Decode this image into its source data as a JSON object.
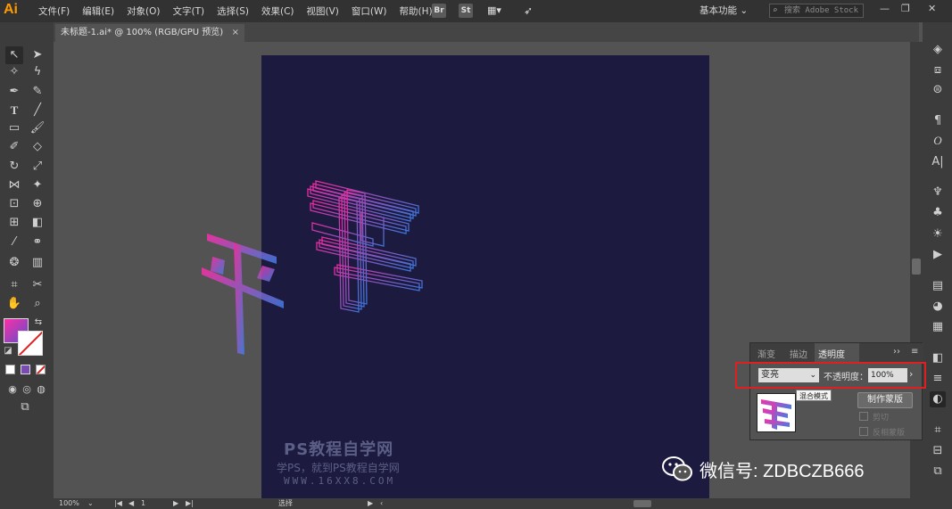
{
  "app": {
    "logo": "Ai"
  },
  "menu": [
    "文件(F)",
    "编辑(E)",
    "对象(O)",
    "文字(T)",
    "选择(S)",
    "效果(C)",
    "视图(V)",
    "窗口(W)",
    "帮助(H)"
  ],
  "menubar_icons": {
    "br": "Br",
    "st": "St"
  },
  "workspace": "基本功能",
  "stock_search": {
    "placeholder": "搜索 Adobe Stock"
  },
  "document_tab": {
    "title": "未标题-1.ai* @ 100% (RGB/GPU 预览)",
    "close": "×"
  },
  "transparency_panel": {
    "tabs": [
      "渐变",
      "描边",
      "透明度"
    ],
    "active_tab": "透明度",
    "blend_mode": "变亮",
    "opacity_label": "不透明度：",
    "opacity_value": "100%",
    "tooltip": "混合模式",
    "make_mask_label": "制作蒙版",
    "checkboxes": [
      "剪切",
      "反相蒙版"
    ]
  },
  "status": {
    "zoom": "100%",
    "page": "1",
    "selection": "选择"
  },
  "watermark": {
    "title": "PS教程自学网",
    "subtitle": "学PS，就到PS教程自学网",
    "url": "WWW.16XX8.COM"
  },
  "wechat": {
    "text": "微信号: ZDBCZB666"
  },
  "colors": {
    "accent_pink": "#ff2da8",
    "accent_blue": "#4a7de0",
    "artboard": "#1d1a40",
    "highlight": "#e02020"
  }
}
